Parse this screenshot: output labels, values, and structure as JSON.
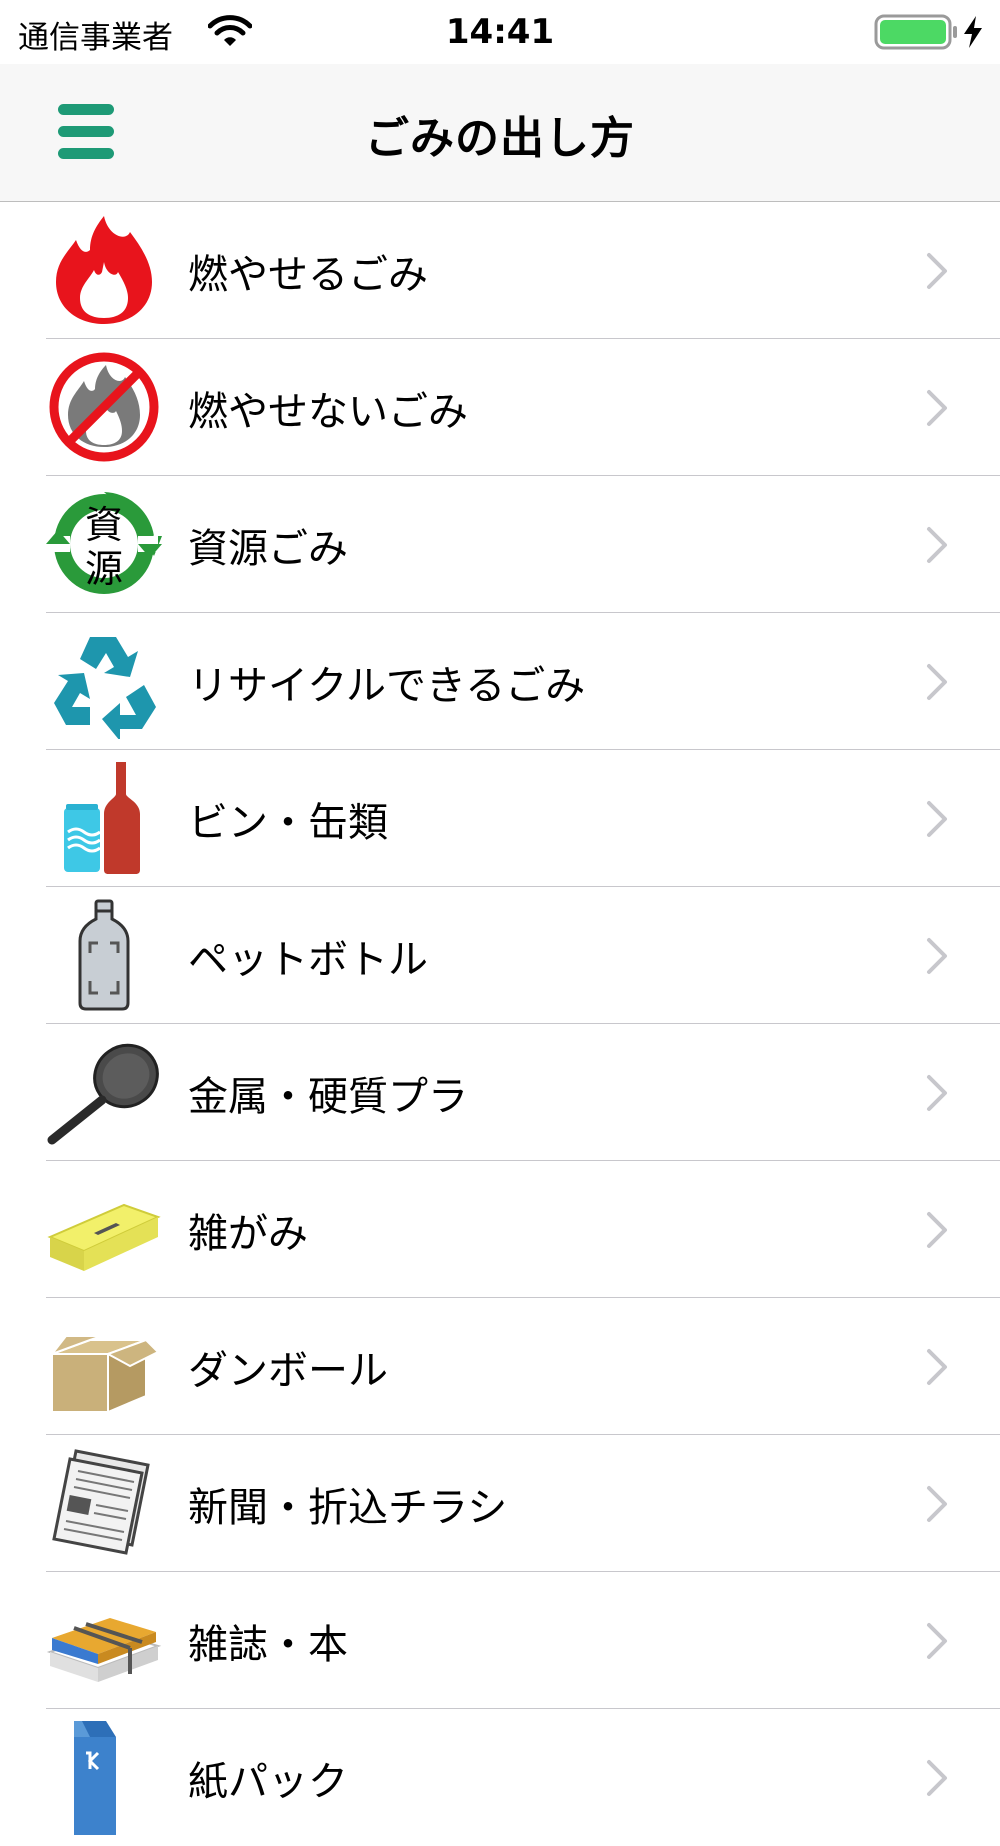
{
  "status_bar": {
    "carrier": "通信事業者",
    "time": "14:41",
    "wifi_icon": "wifi-icon",
    "battery_icon": "battery-icon",
    "charging_icon": "charging-bolt-icon",
    "battery_color": "#4cd964"
  },
  "nav": {
    "title": "ごみの出し方",
    "menu_icon": "hamburger-menu-icon",
    "accent_color": "#1e9a76"
  },
  "list": {
    "items": [
      {
        "label": "燃やせるごみ",
        "icon": "burnable-fire-icon"
      },
      {
        "label": "燃やせないごみ",
        "icon": "non-burnable-icon"
      },
      {
        "label": "資源ごみ",
        "icon": "resource-recycle-icon",
        "icon_text_top": "資",
        "icon_text_bottom": "源"
      },
      {
        "label": "リサイクルできるごみ",
        "icon": "recycle-symbol-icon"
      },
      {
        "label": "ビン・缶類",
        "icon": "bottle-can-icon"
      },
      {
        "label": "ペットボトル",
        "icon": "pet-bottle-icon"
      },
      {
        "label": "金属・硬質プラ",
        "icon": "frying-pan-icon"
      },
      {
        "label": "雑がみ",
        "icon": "tissue-box-icon"
      },
      {
        "label": "ダンボール",
        "icon": "cardboard-box-icon"
      },
      {
        "label": "新聞・折込チラシ",
        "icon": "newspaper-icon"
      },
      {
        "label": "雑誌・本",
        "icon": "magazines-icon"
      },
      {
        "label": "紙パック",
        "icon": "milk-carton-icon"
      }
    ]
  }
}
